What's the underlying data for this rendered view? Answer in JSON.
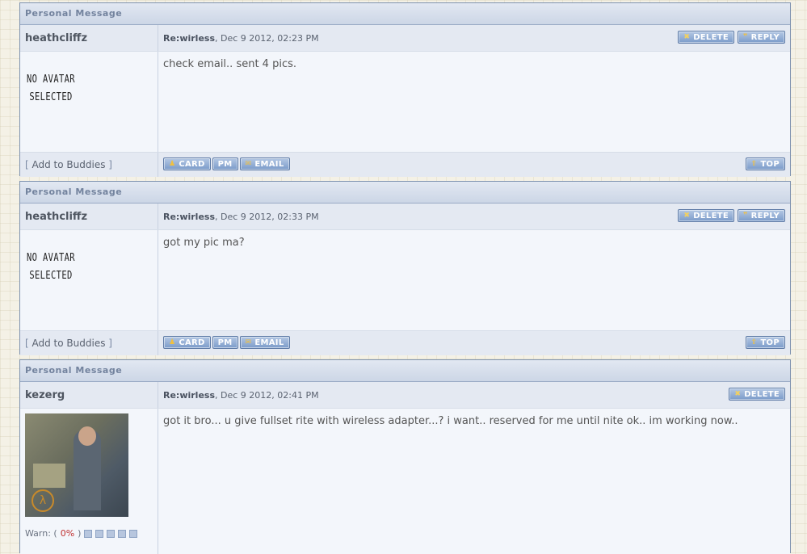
{
  "messages": [
    {
      "header": "Personal Message",
      "username": "heathcliffz",
      "subject": "Re:wirless",
      "date": ", Dec 9 2012, 02:23 PM",
      "body": "check email.. sent 4 pics.",
      "avatar_line1": "NO AVATAR",
      "avatar_line2": "SELECTED",
      "add_buddies": "Add to Buddies"
    },
    {
      "header": "Personal Message",
      "username": "heathcliffz",
      "subject": "Re:wirless",
      "date": ", Dec 9 2012, 02:33 PM",
      "body": "got my pic ma?",
      "avatar_line1": "NO AVATAR",
      "avatar_line2": "SELECTED",
      "add_buddies": "Add to Buddies"
    },
    {
      "header": "Personal Message",
      "username": "kezerg",
      "subject": "Re:wirless",
      "date": ", Dec 9 2012, 02:41 PM",
      "body": "got it bro... u give fullset rite with wireless adapter...? i want.. reserved for me until nite ok.. im working now..",
      "warn_label": "Warn: (",
      "warn_pct": "0%",
      "warn_close": ")"
    }
  ],
  "buttons": {
    "delete": "DELETE",
    "reply": "REPLY",
    "card": "CARD",
    "pm": "PM",
    "email": "EMAIL",
    "top": "TOP"
  },
  "brackets": {
    "open": "[ ",
    "close": " ]"
  },
  "icons": {
    "delete": "close-icon",
    "reply": "quote-icon",
    "card": "user-icon",
    "email": "envelope-icon",
    "top": "arrow-up-icon"
  }
}
